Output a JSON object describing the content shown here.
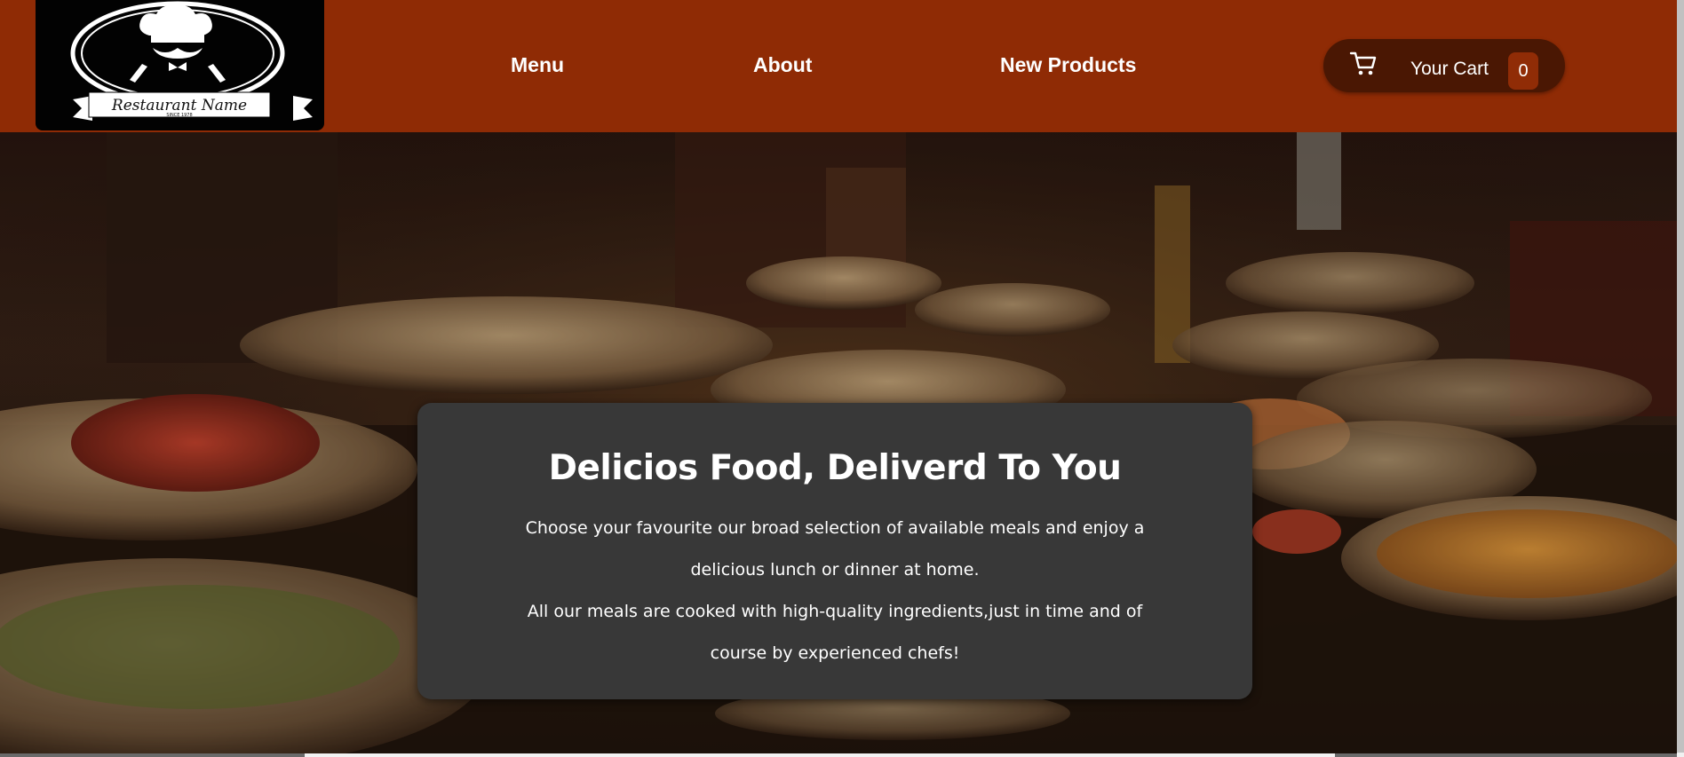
{
  "logo": {
    "alt": "Restaurant logo",
    "banner_text": "Restaurant Name",
    "since_text": "SINCE 1978"
  },
  "nav": {
    "items": [
      {
        "label": "Menu"
      },
      {
        "label": "About"
      },
      {
        "label": "New Products"
      }
    ]
  },
  "cart": {
    "label": "Your Cart",
    "count": "0",
    "icon": "cart-icon"
  },
  "summary": {
    "title": "Delicios Food, Deliverd To You",
    "paragraph1": "Choose your favourite our broad selection of available meals and enjoy a delicious lunch or dinner at home.",
    "paragraph2": "All our meals are cooked with high-quality ingredients,just in time and of course by experienced chefs!"
  },
  "colors": {
    "header_bg": "#8f2b05",
    "cart_bg": "#4a1703",
    "badge_bg": "#902c06",
    "summary_bg": "#383838"
  }
}
